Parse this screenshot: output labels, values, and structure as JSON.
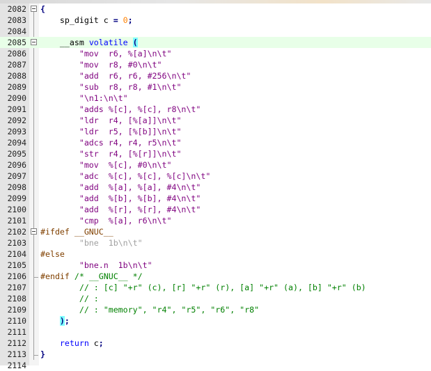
{
  "editor": {
    "lines": [
      {
        "n": "2082",
        "parts": [
          {
            "t": "{",
            "c": "op"
          }
        ]
      },
      {
        "n": "2083",
        "parts": [
          {
            "t": "    sp_digit c "
          },
          {
            "t": "=",
            "c": "op"
          },
          {
            "t": " "
          },
          {
            "t": "0",
            "c": "num"
          },
          {
            "t": ";",
            "c": "op"
          }
        ]
      },
      {
        "n": "2084",
        "parts": []
      },
      {
        "n": "2085",
        "parts": [
          {
            "t": "    __asm "
          },
          {
            "t": "volatile",
            "c": "kw"
          },
          {
            "t": " "
          },
          {
            "t": "(",
            "c": "paren-hl"
          }
        ]
      },
      {
        "n": "2086",
        "parts": [
          {
            "t": "        "
          },
          {
            "t": "\"mov  r6, %[a]\\n\\t\"",
            "c": "str"
          }
        ]
      },
      {
        "n": "2087",
        "parts": [
          {
            "t": "        "
          },
          {
            "t": "\"mov  r8, #0\\n\\t\"",
            "c": "str"
          }
        ]
      },
      {
        "n": "2088",
        "parts": [
          {
            "t": "        "
          },
          {
            "t": "\"add  r6, r6, #256\\n\\t\"",
            "c": "str"
          }
        ]
      },
      {
        "n": "2089",
        "parts": [
          {
            "t": "        "
          },
          {
            "t": "\"sub  r8, r8, #1\\n\\t\"",
            "c": "str"
          }
        ]
      },
      {
        "n": "2090",
        "parts": [
          {
            "t": "        "
          },
          {
            "t": "\"\\n1:\\n\\t\"",
            "c": "str"
          }
        ]
      },
      {
        "n": "2091",
        "parts": [
          {
            "t": "        "
          },
          {
            "t": "\"adds %[c], %[c], r8\\n\\t\"",
            "c": "str"
          }
        ]
      },
      {
        "n": "2092",
        "parts": [
          {
            "t": "        "
          },
          {
            "t": "\"ldr  r4, [%[a]]\\n\\t\"",
            "c": "str"
          }
        ]
      },
      {
        "n": "2093",
        "parts": [
          {
            "t": "        "
          },
          {
            "t": "\"ldr  r5, [%[b]]\\n\\t\"",
            "c": "str"
          }
        ]
      },
      {
        "n": "2094",
        "parts": [
          {
            "t": "        "
          },
          {
            "t": "\"adcs r4, r4, r5\\n\\t\"",
            "c": "str"
          }
        ]
      },
      {
        "n": "2095",
        "parts": [
          {
            "t": "        "
          },
          {
            "t": "\"str  r4, [%[r]]\\n\\t\"",
            "c": "str"
          }
        ]
      },
      {
        "n": "2096",
        "parts": [
          {
            "t": "        "
          },
          {
            "t": "\"mov  %[c], #0\\n\\t\"",
            "c": "str"
          }
        ]
      },
      {
        "n": "2097",
        "parts": [
          {
            "t": "        "
          },
          {
            "t": "\"adc  %[c], %[c], %[c]\\n\\t\"",
            "c": "str"
          }
        ]
      },
      {
        "n": "2098",
        "parts": [
          {
            "t": "        "
          },
          {
            "t": "\"add  %[a], %[a], #4\\n\\t\"",
            "c": "str"
          }
        ]
      },
      {
        "n": "2099",
        "parts": [
          {
            "t": "        "
          },
          {
            "t": "\"add  %[b], %[b], #4\\n\\t\"",
            "c": "str"
          }
        ]
      },
      {
        "n": "2100",
        "parts": [
          {
            "t": "        "
          },
          {
            "t": "\"add  %[r], %[r], #4\\n\\t\"",
            "c": "str"
          }
        ]
      },
      {
        "n": "2101",
        "parts": [
          {
            "t": "        "
          },
          {
            "t": "\"cmp  %[a], r6\\n\\t\"",
            "c": "str"
          }
        ]
      },
      {
        "n": "2102",
        "parts": [
          {
            "t": "#ifdef __GNUC__",
            "c": "pre"
          }
        ]
      },
      {
        "n": "2103",
        "parts": [
          {
            "t": "        "
          },
          {
            "t": "\"bne  1b\\n\\t\"",
            "c": "strdim"
          }
        ]
      },
      {
        "n": "2104",
        "parts": [
          {
            "t": "#else",
            "c": "pre"
          }
        ]
      },
      {
        "n": "2105",
        "parts": [
          {
            "t": "        "
          },
          {
            "t": "\"bne.n  1b\\n\\t\"",
            "c": "str"
          }
        ]
      },
      {
        "n": "2106",
        "parts": [
          {
            "t": "#endif",
            "c": "pre"
          },
          {
            "t": " "
          },
          {
            "t": "/* __GNUC__ */",
            "c": "cmt"
          }
        ]
      },
      {
        "n": "2107",
        "parts": [
          {
            "t": "        "
          },
          {
            "t": "// : [c] \"+r\" (c), [r] \"+r\" (r), [a] \"+r\" (a), [b] \"+r\" (b)",
            "c": "cmt"
          }
        ]
      },
      {
        "n": "2108",
        "parts": [
          {
            "t": "        "
          },
          {
            "t": "// :",
            "c": "cmt"
          }
        ]
      },
      {
        "n": "2109",
        "parts": [
          {
            "t": "        "
          },
          {
            "t": "// : \"memory\", \"r4\", \"r5\", \"r6\", \"r8\"",
            "c": "cmt"
          }
        ]
      },
      {
        "n": "2110",
        "parts": [
          {
            "t": "    "
          },
          {
            "t": ")",
            "c": "paren-hl"
          },
          {
            "t": ";",
            "c": "op"
          }
        ]
      },
      {
        "n": "2111",
        "parts": []
      },
      {
        "n": "2112",
        "parts": [
          {
            "t": "    "
          },
          {
            "t": "return",
            "c": "kw"
          },
          {
            "t": " c"
          },
          {
            "t": ";",
            "c": "op"
          }
        ]
      },
      {
        "n": "2113",
        "parts": [
          {
            "t": "}",
            "c": "op"
          }
        ]
      },
      {
        "n": "2114",
        "parts": []
      }
    ],
    "fold_markers": [
      "2082",
      "2085",
      "2102"
    ],
    "current_line": "2085",
    "colors": {
      "keyword": "#0000ff",
      "number": "#ff8000",
      "string": "#7f007f",
      "preprocessor": "#804000",
      "comment": "#008000",
      "operator": "#000080",
      "brace_highlight": "#80ffff",
      "current_line": "#e8ffe8"
    }
  }
}
